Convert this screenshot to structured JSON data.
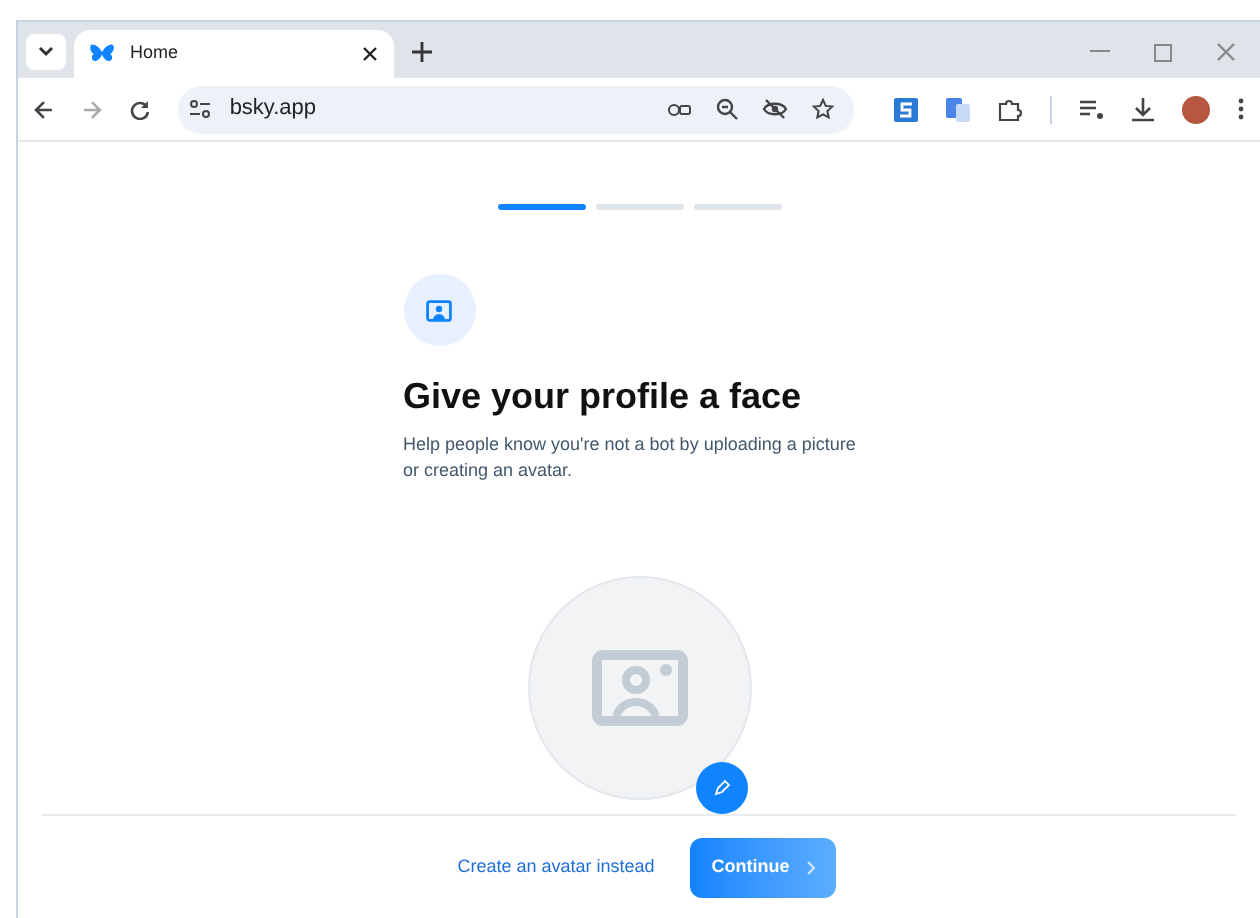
{
  "browser": {
    "tabs": [
      {
        "label": "Home",
        "selected": true
      }
    ],
    "address": "bsky.app"
  },
  "progress": [
    {
      "selected": true
    },
    {
      "selected": false
    },
    {
      "selected": false
    }
  ],
  "title": "Give your profile a face",
  "description": "Help people know you're not a bot by uploading a picture or creating an avatar.",
  "actions": {
    "link": "Create an avatar instead",
    "button": "Continue"
  }
}
